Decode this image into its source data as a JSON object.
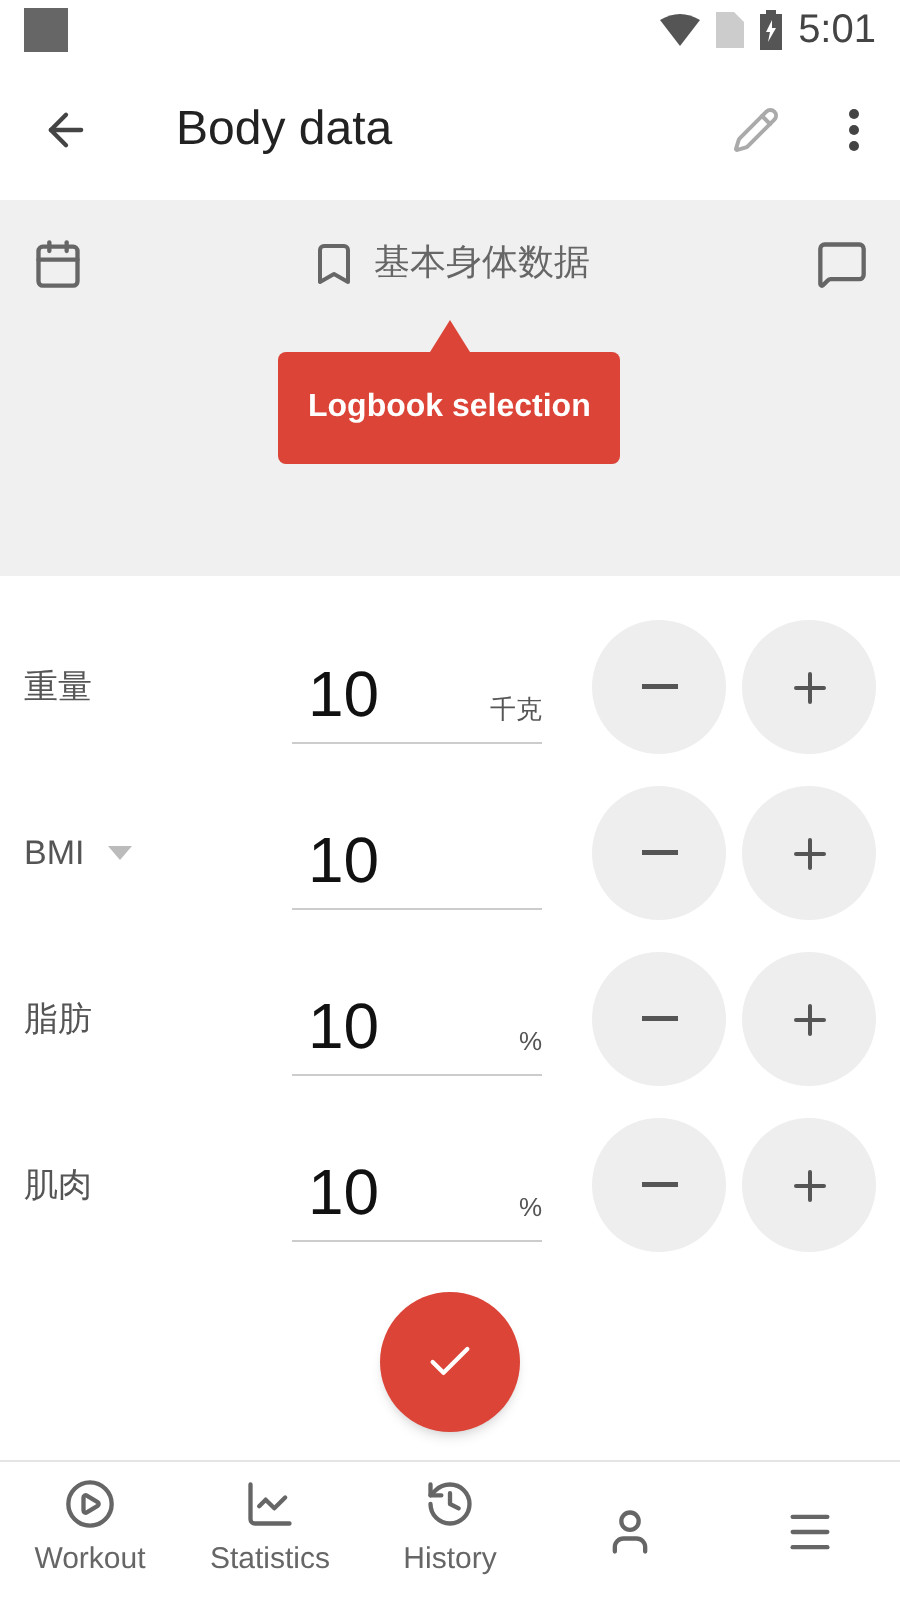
{
  "status_bar": {
    "time": "5:01"
  },
  "app_bar": {
    "title": "Body data"
  },
  "logbook": {
    "name": "基本身体数据",
    "tooltip": "Logbook selection"
  },
  "fields": [
    {
      "label": "重量",
      "value": "10",
      "unit": "千克",
      "dropdown": false
    },
    {
      "label": "BMI",
      "value": "10",
      "dropdown": true
    },
    {
      "label": "脂肪",
      "value": "10",
      "unit": "%",
      "dropdown": false
    },
    {
      "label": "肌肉",
      "value": "10",
      "unit": "%",
      "dropdown": false
    }
  ],
  "bottom_nav": [
    {
      "kind": "labeled",
      "label": "Workout"
    },
    {
      "kind": "labeled",
      "label": "Statistics"
    },
    {
      "kind": "labeled",
      "label": "History"
    },
    {
      "kind": "icon"
    },
    {
      "kind": "icon"
    }
  ]
}
